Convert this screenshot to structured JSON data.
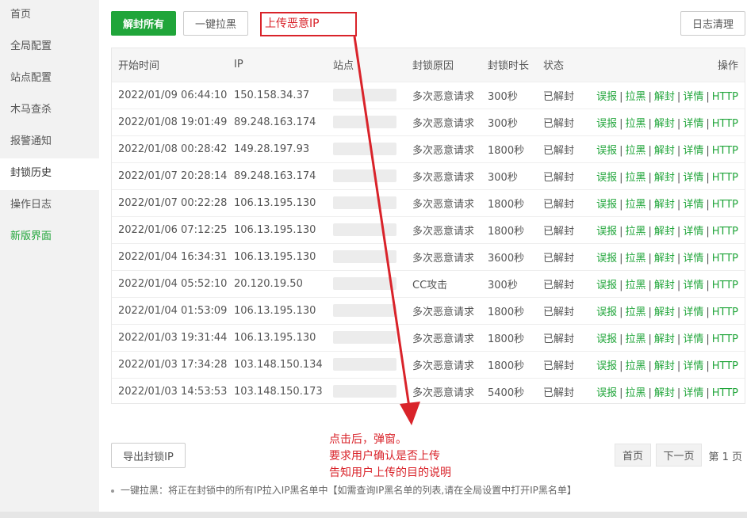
{
  "sidebar": {
    "items": [
      {
        "label": "首页"
      },
      {
        "label": "全局配置"
      },
      {
        "label": "站点配置"
      },
      {
        "label": "木马查杀"
      },
      {
        "label": "报警通知"
      },
      {
        "label": "封锁历史"
      },
      {
        "label": "操作日志"
      },
      {
        "label": "新版界面"
      }
    ]
  },
  "toolbar": {
    "unblock_all": "解封所有",
    "blacklist_all": "一键拉黑",
    "upload_ip": "上传恶意IP",
    "clear_log": "日志清理"
  },
  "table": {
    "headers": [
      "开始时间",
      "IP",
      "站点",
      "封锁原因",
      "封锁时长",
      "状态",
      "操作"
    ],
    "rows": [
      {
        "time": "2022/01/09 06:44:10",
        "ip": "150.158.34.37",
        "reason": "多次恶意请求",
        "duration": "300秒",
        "status": "已解封"
      },
      {
        "time": "2022/01/08 19:01:49",
        "ip": "89.248.163.174",
        "reason": "多次恶意请求",
        "duration": "300秒",
        "status": "已解封"
      },
      {
        "time": "2022/01/08 00:28:42",
        "ip": "149.28.197.93",
        "reason": "多次恶意请求",
        "duration": "1800秒",
        "status": "已解封"
      },
      {
        "time": "2022/01/07 20:28:14",
        "ip": "89.248.163.174",
        "reason": "多次恶意请求",
        "duration": "300秒",
        "status": "已解封"
      },
      {
        "time": "2022/01/07 00:22:28",
        "ip": "106.13.195.130",
        "reason": "多次恶意请求",
        "duration": "1800秒",
        "status": "已解封"
      },
      {
        "time": "2022/01/06 07:12:25",
        "ip": "106.13.195.130",
        "reason": "多次恶意请求",
        "duration": "1800秒",
        "status": "已解封"
      },
      {
        "time": "2022/01/04 16:34:31",
        "ip": "106.13.195.130",
        "reason": "多次恶意请求",
        "duration": "3600秒",
        "status": "已解封"
      },
      {
        "time": "2022/01/04 05:52:10",
        "ip": "20.120.19.50",
        "reason": "CC攻击",
        "duration": "300秒",
        "status": "已解封"
      },
      {
        "time": "2022/01/04 01:53:09",
        "ip": "106.13.195.130",
        "reason": "多次恶意请求",
        "duration": "1800秒",
        "status": "已解封"
      },
      {
        "time": "2022/01/03 19:31:44",
        "ip": "106.13.195.130",
        "reason": "多次恶意请求",
        "duration": "1800秒",
        "status": "已解封"
      },
      {
        "time": "2022/01/03 17:34:28",
        "ip": "103.148.150.134",
        "reason": "多次恶意请求",
        "duration": "1800秒",
        "status": "已解封"
      },
      {
        "time": "2022/01/03 14:53:53",
        "ip": "103.148.150.173",
        "reason": "多次恶意请求",
        "duration": "5400秒",
        "status": "已解封"
      }
    ],
    "ops": [
      "误报",
      "拉黑",
      "解封",
      "详情",
      "HTTP"
    ]
  },
  "footer": {
    "export": "导出封锁IP",
    "first_page": "首页",
    "next_page": "下一页",
    "page_info": "第 1 页",
    "tip": "一键拉黑：将正在封锁中的所有IP拉入IP黑名单中【如需查询IP黑名单的列表,请在全局设置中打开IP黑名单】"
  },
  "annotation": {
    "line1": "点击后，弹窗。",
    "line2": "要求用户确认是否上传",
    "line3": "告知用户上传的目的说明"
  },
  "colors": {
    "primary": "#20a53a",
    "annotation": "#d9232a"
  }
}
